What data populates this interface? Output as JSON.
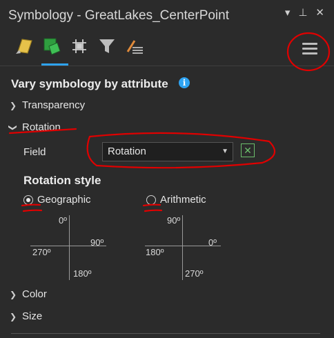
{
  "window": {
    "title": "Symbology - GreatLakes_CenterPoint",
    "icons": [
      "dropdown-arrow-icon",
      "pin-icon",
      "close-icon"
    ]
  },
  "toolbar": {
    "tools": [
      "primary-symbology-icon",
      "vary-by-attribute-icon",
      "labeling-icon",
      "filter-icon",
      "symbol-layer-drawing-icon"
    ],
    "active_index": 1,
    "menu_icon": "hamburger-menu-icon"
  },
  "main": {
    "heading": "Vary symbology by attribute",
    "info_icon": "info-icon",
    "sections": {
      "transparency": "Transparency",
      "rotation": "Rotation",
      "color": "Color",
      "size": "Size"
    },
    "rotation": {
      "field_label": "Field",
      "field_value": "Rotation",
      "expression_icon": "expression-builder-icon",
      "style_heading": "Rotation style",
      "options": [
        {
          "label": "Geographic",
          "selected": true
        },
        {
          "label": "Arithmetic",
          "selected": false
        }
      ],
      "geographic_compass": {
        "top": "0º",
        "right": "90º",
        "bottom": "180º",
        "left": "270º"
      },
      "arithmetic_compass": {
        "top": "90º",
        "right": "0º",
        "bottom": "270º",
        "left": "180º"
      }
    }
  },
  "colors": {
    "background": "#2b2b2b",
    "accent": "#2ea3f2",
    "annotation": "#e00000"
  }
}
